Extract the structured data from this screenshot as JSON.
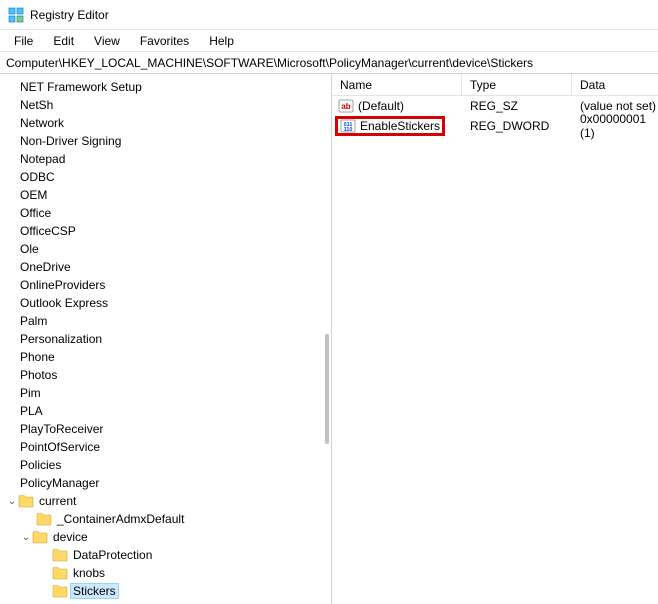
{
  "window": {
    "title": "Registry Editor"
  },
  "menu": [
    "File",
    "Edit",
    "View",
    "Favorites",
    "Help"
  ],
  "address": "Computer\\HKEY_LOCAL_MACHINE\\SOFTWARE\\Microsoft\\PolicyManager\\current\\device\\Stickers",
  "tree": {
    "plain": [
      "NET Framework Setup",
      "NetSh",
      "Network",
      "Non-Driver Signing",
      "Notepad",
      "ODBC",
      "OEM",
      "Office",
      "OfficeCSP",
      "Ole",
      "OneDrive",
      "OnlineProviders",
      "Outlook Express",
      "Palm",
      "Personalization",
      "Phone",
      "Photos",
      "Pim",
      "PLA",
      "PlayToReceiver",
      "PointOfService",
      "Policies",
      "PolicyManager"
    ],
    "current": {
      "label": "current",
      "child": "_ContainerAdmxDefault"
    },
    "device": {
      "label": "device",
      "children": [
        "DataProtection",
        "knobs",
        "Stickers"
      ]
    }
  },
  "columns": {
    "name": "Name",
    "type": "Type",
    "data": "Data"
  },
  "values": [
    {
      "icon": "string",
      "name": "(Default)",
      "type": "REG_SZ",
      "data": "(value not set)",
      "highlight": false
    },
    {
      "icon": "dword",
      "name": "EnableStickers",
      "type": "REG_DWORD",
      "data": "0x00000001 (1)",
      "highlight": true
    }
  ]
}
